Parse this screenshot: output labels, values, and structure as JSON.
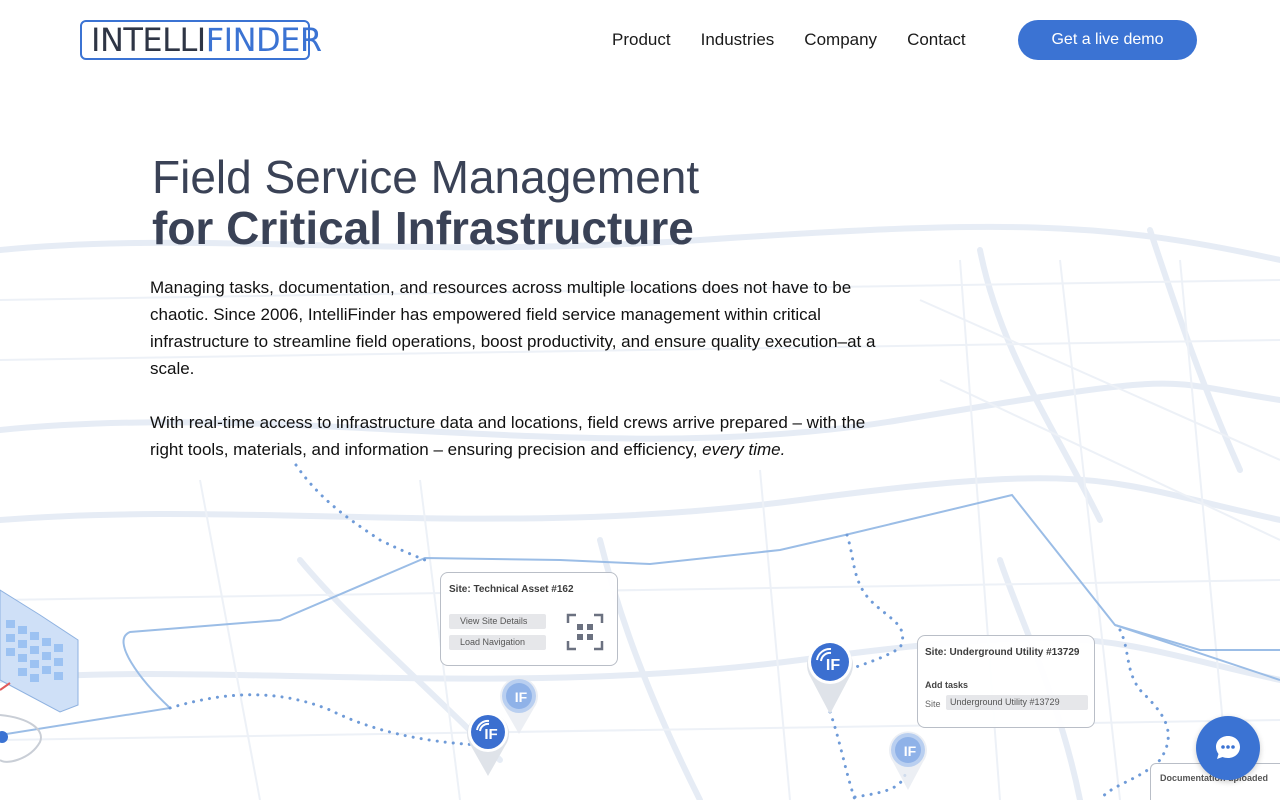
{
  "header": {
    "logo": {
      "part1": "INTELLI",
      "part2": "FINDER"
    },
    "nav": [
      {
        "label": "Product"
      },
      {
        "label": "Industries"
      },
      {
        "label": "Company"
      },
      {
        "label": "Contact"
      }
    ],
    "cta_label": "Get a live demo"
  },
  "hero": {
    "title_line1": "Field Service Management",
    "title_line2": "for Critical Infrastructure",
    "paragraph1": "Managing tasks, documentation, and resources across multiple locations does not have to be chaotic. Since 2006, IntelliFinder has empowered field service management within critical infrastructure to streamline field operations, boost productivity, and ensure quality execution–at a scale.",
    "paragraph2": "With real-time access to infrastructure data and locations, field crews arrive prepared – with the right tools, materials, and information – ensuring precision and efficiency, ",
    "paragraph2_emphasis": "every time."
  },
  "illustration": {
    "card1": {
      "title": "Site: Technical Asset #162",
      "button1": "View Site Details",
      "button2": "Load Navigation"
    },
    "card2": {
      "title": "Site: Underground Utility #13729",
      "subtitle": "Add tasks",
      "field_label": "Site",
      "field_value": "Underground Utility #13729"
    },
    "card3": {
      "title": "Documentation uploaded"
    },
    "pin_text": "IF"
  },
  "colors": {
    "brand_blue": "#3b73d3",
    "heading": "#3a4256",
    "route": "#8fb2e0"
  }
}
